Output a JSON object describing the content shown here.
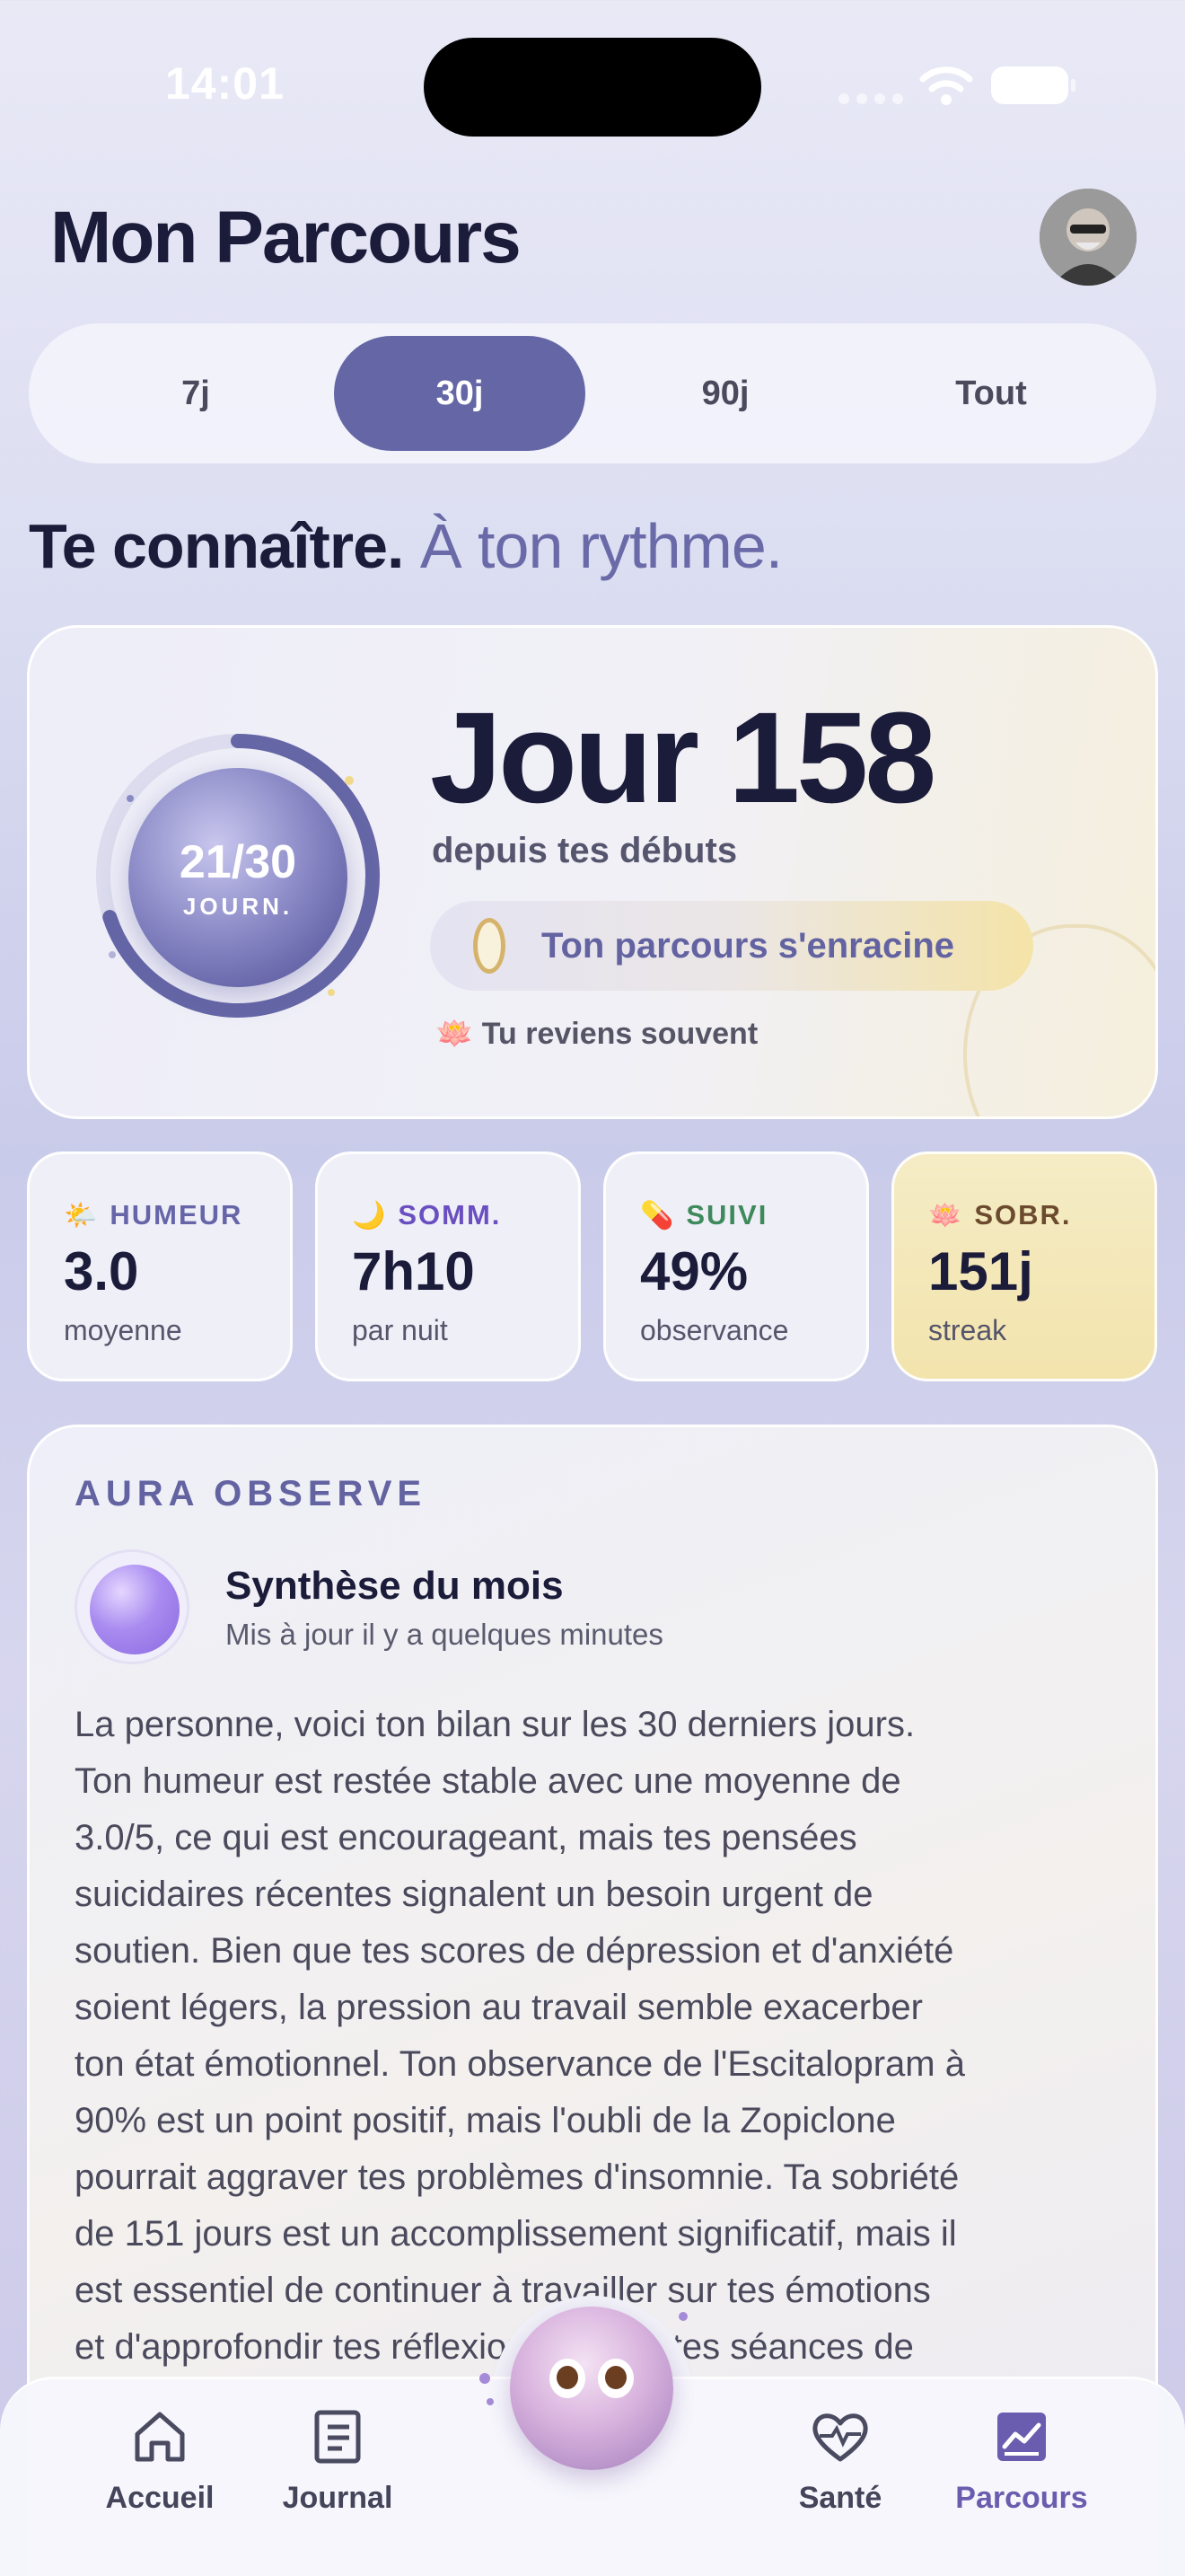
{
  "status_bar": {
    "time": "14:01"
  },
  "header": {
    "title": "Mon Parcours"
  },
  "period_tabs": [
    {
      "label": "7j",
      "active": false
    },
    {
      "label": "30j",
      "active": true
    },
    {
      "label": "90j",
      "active": false
    },
    {
      "label": "Tout",
      "active": false
    }
  ],
  "tagline": {
    "bold": "Te connaître.",
    "light": "À ton rythme."
  },
  "hero": {
    "progress_value": "21/30",
    "progress_unit": "JOURN.",
    "progress_fraction": 0.7,
    "day_title": "Jour 158",
    "day_subtitle": "depuis tes débuts",
    "badge_label": "Ton parcours s'enracine",
    "note_icon": "lotus-icon",
    "note": "Tu reviens souvent"
  },
  "stats": [
    {
      "icon": "sun-cloud-icon",
      "label": "HUMEUR",
      "value": "3.0",
      "unit": "moyenne",
      "color": "#6565a8"
    },
    {
      "icon": "moon-icon",
      "label": "SOMM.",
      "value": "7h10",
      "unit": "par nuit",
      "color": "#6a4fc0"
    },
    {
      "icon": "pill-icon",
      "label": "SUIVI",
      "value": "49%",
      "unit": "observance",
      "color": "#3f8a5c"
    },
    {
      "icon": "lotus-icon",
      "label": "SOBR.",
      "value": "151j",
      "unit": "streak",
      "color": "#6b4a2e"
    }
  ],
  "aura": {
    "heading": "AURA OBSERVE",
    "title": "Synthèse du mois",
    "updated": "Mis à jour il y a quelques minutes",
    "lines": [
      "La personne, voici ton bilan sur les 30 derniers jours.",
      "Ton humeur est restée stable avec une moyenne de",
      "3.0/5, ce qui est encourageant, mais tes pensées",
      "suicidaires récentes signalent un besoin urgent de",
      "soutien. Bien que tes scores de dépression et d'anxiété",
      "soient légers, la pression au travail semble exacerber",
      "ton état émotionnel. Ton observance de l'Escitalopram à",
      "90% est un point positif, mais l'oubli de la Zopiclone",
      "pourrait aggraver tes problèmes d'insomnie. Ta sobriété",
      "de 151 jours est un accomplissement significatif, mais il",
      "est essentiel de continuer à travailler sur tes émotions",
      "et d'approfondir tes réflexions lors de tes séances de"
    ]
  },
  "nav": {
    "items": [
      {
        "label": "Accueil",
        "icon": "home-icon"
      },
      {
        "label": "Journal",
        "icon": "journal-icon"
      },
      {
        "label": "Santé",
        "icon": "heart-pulse-icon"
      },
      {
        "label": "Parcours",
        "icon": "chart-icon",
        "active": true
      }
    ]
  },
  "colors": {
    "accent": "#6566a6",
    "gold": "#f3e4ad"
  }
}
